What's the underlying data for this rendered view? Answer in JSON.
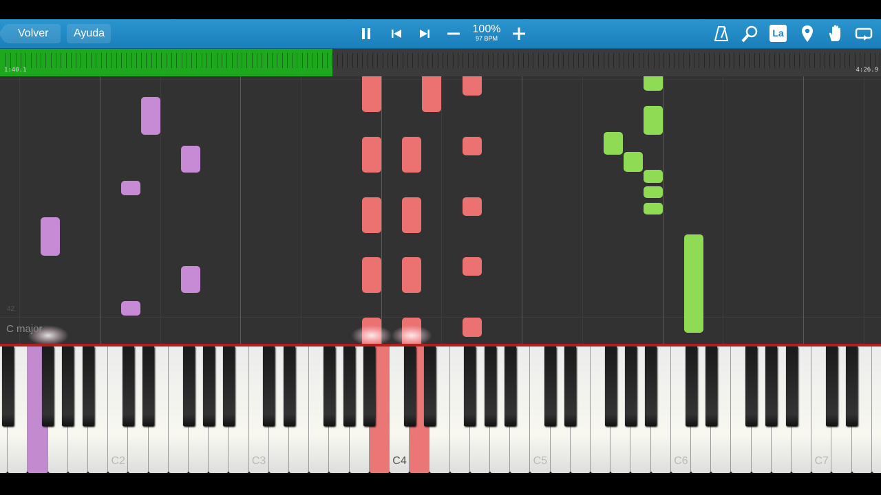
{
  "toolbar": {
    "back_label": "Volver",
    "help_label": "Ayuda",
    "tempo_percent": "100%",
    "tempo_bpm": "97 BPM",
    "key_label": "La",
    "icons": [
      "pause-icon",
      "previous-icon",
      "next-icon",
      "minus-icon",
      "plus-icon",
      "metronome-icon",
      "magnifier-icon",
      "key-signature-icon",
      "location-pin-icon",
      "hand-icon",
      "loop-icon"
    ]
  },
  "progress": {
    "current_time": "1:40.1",
    "total_time": "4:26.9",
    "fraction": 0.377
  },
  "roll": {
    "chord_label": "C major",
    "measure_number": "42"
  },
  "keyboard": {
    "octave_labels": [
      "C2",
      "C3",
      "C4",
      "C5",
      "C6",
      "C7"
    ],
    "active_label": "C4"
  },
  "colors": {
    "left_hand": "#c78ad4",
    "right_hand": "#ec7272",
    "melody": "#8fdc54",
    "toolbar": "#1f88c2",
    "progress": "#1ea81e"
  }
}
